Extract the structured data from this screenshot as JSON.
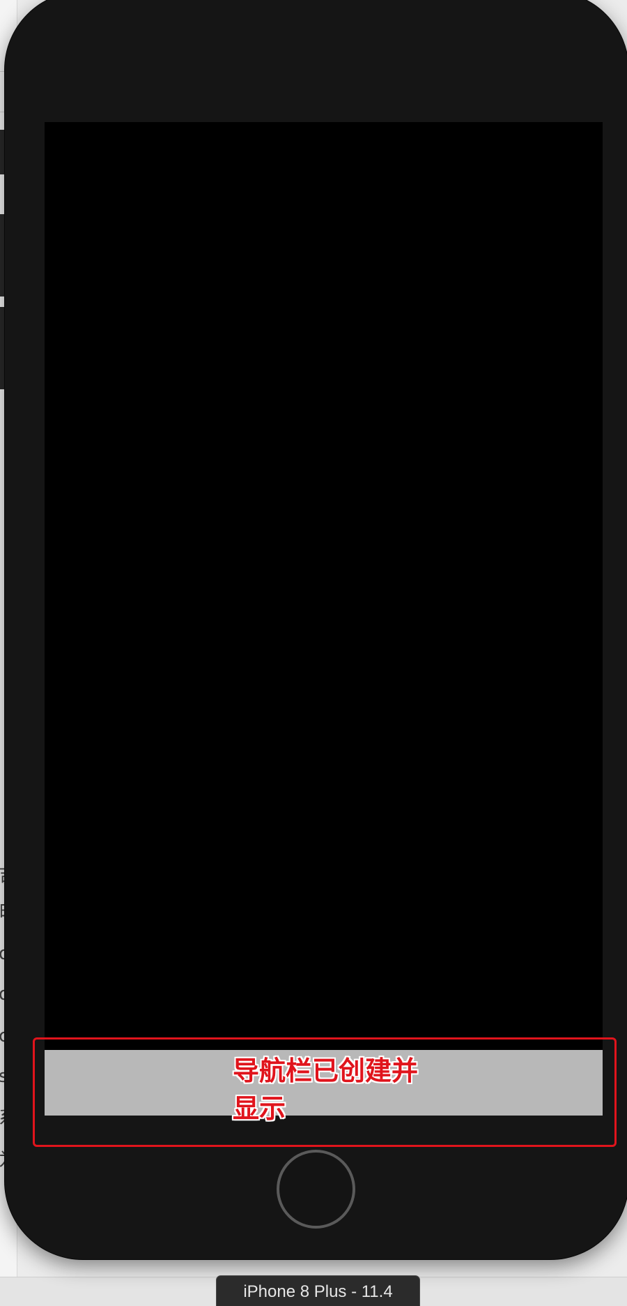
{
  "simulator": {
    "device_title": "iPhone 8 Plus - 11.4"
  },
  "annotation": {
    "text": "导航栏已创建并显示",
    "color": "#e0141c"
  },
  "app_screen": {
    "background": "#000000",
    "navigation_bar_color": "#b8b8b8"
  },
  "background_window": {
    "partial_chars": [
      "吉",
      "由",
      "o",
      "o",
      "c",
      "s",
      "系",
      "为"
    ]
  }
}
